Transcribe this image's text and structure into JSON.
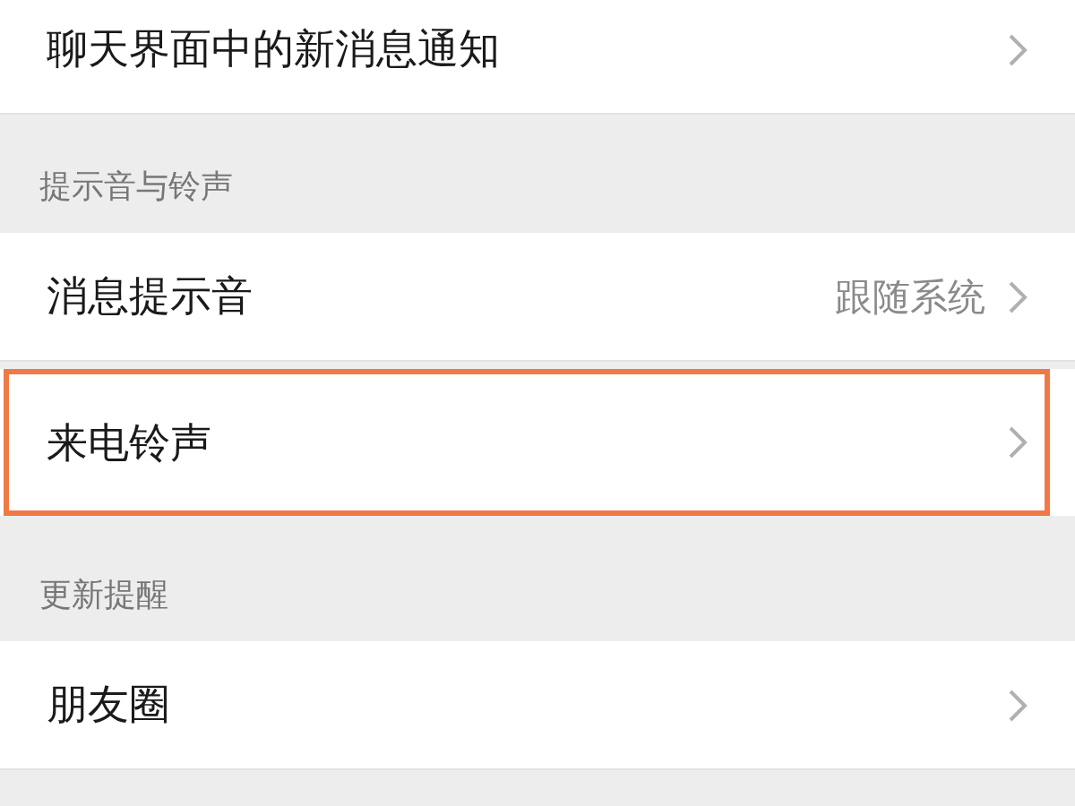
{
  "groups": [
    {
      "rows": [
        {
          "label": "聊天界面中的新消息通知",
          "highlighted": false
        }
      ]
    },
    {
      "header": "提示音与铃声",
      "rows": [
        {
          "label": "消息提示音",
          "value": "跟随系统",
          "highlighted": false
        },
        {
          "label": "来电铃声",
          "highlighted": true
        }
      ]
    },
    {
      "header": "更新提醒",
      "rows": [
        {
          "label": "朋友圈",
          "highlighted": false
        }
      ]
    }
  ]
}
